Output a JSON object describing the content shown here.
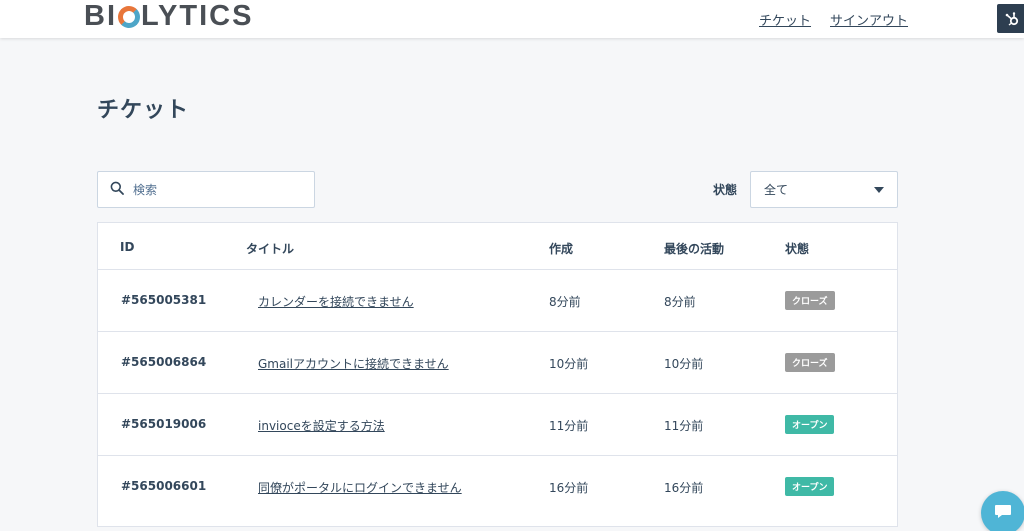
{
  "header": {
    "logo": {
      "prefix": "BI",
      "suffix": "LYTICS"
    },
    "nav": {
      "tickets": "チケット",
      "signout": "サインアウト"
    }
  },
  "page": {
    "title": "チケット"
  },
  "search": {
    "placeholder": "検索",
    "value": ""
  },
  "filter": {
    "label": "状態",
    "selected": "全て"
  },
  "table": {
    "columns": {
      "id": "ID",
      "title": "タイトル",
      "created": "作成",
      "last": "最後の活動",
      "status": "状態"
    },
    "rows": [
      {
        "id": "#565005381",
        "title": "カレンダーを接続できません",
        "created": "8分前",
        "last": "8分前",
        "status": "クローズ",
        "status_color": "#9b9b9b"
      },
      {
        "id": "#565006864",
        "title": "Gmailアカウントに接続できません",
        "created": "10分前",
        "last": "10分前",
        "status": "クローズ",
        "status_color": "#9b9b9b"
      },
      {
        "id": "#565019006",
        "title": "invioceを設定する方法",
        "created": "11分前",
        "last": "11分前",
        "status": "オープン",
        "status_color": "#3fb9a6"
      },
      {
        "id": "#565006601",
        "title": "同僚がポータルにログインできません",
        "created": "16分前",
        "last": "16分前",
        "status": "オープン",
        "status_color": "#3fb9a6"
      }
    ]
  },
  "icons": {
    "search": "search-icon",
    "caret": "chevron-down-icon",
    "hubspot": "hubspot-icon",
    "chat": "chat-icon"
  },
  "colors": {
    "closed": "#9b9b9b",
    "open": "#3fb9a6",
    "chat": "#4fb5d6"
  }
}
